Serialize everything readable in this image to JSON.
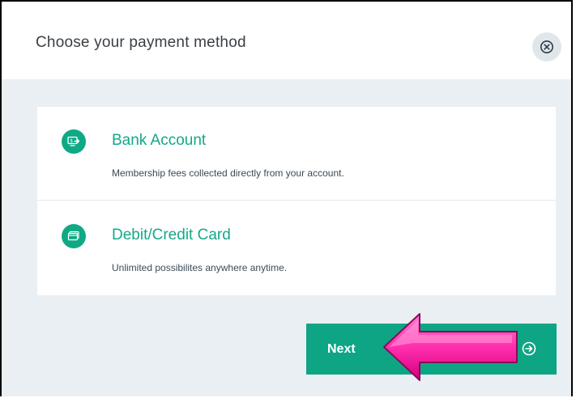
{
  "dialog": {
    "title": "Choose your payment method",
    "close_icon": "close-circle-icon"
  },
  "options": [
    {
      "icon": "bank-transfer-icon",
      "title": "Bank Account",
      "description": "Membership fees collected directly from your account."
    },
    {
      "icon": "credit-card-icon",
      "title": "Debit/Credit Card",
      "description": "Unlimited possibilites anywhere anytime."
    }
  ],
  "footer": {
    "next_label": "Next",
    "next_icon": "arrow-right-circle-icon"
  },
  "annotation": {
    "pointer_icon": "pink-arrow-icon"
  },
  "colors": {
    "accent": "#0ea584",
    "panel": "#e9eff2",
    "pointer": "#ff3eb5"
  }
}
